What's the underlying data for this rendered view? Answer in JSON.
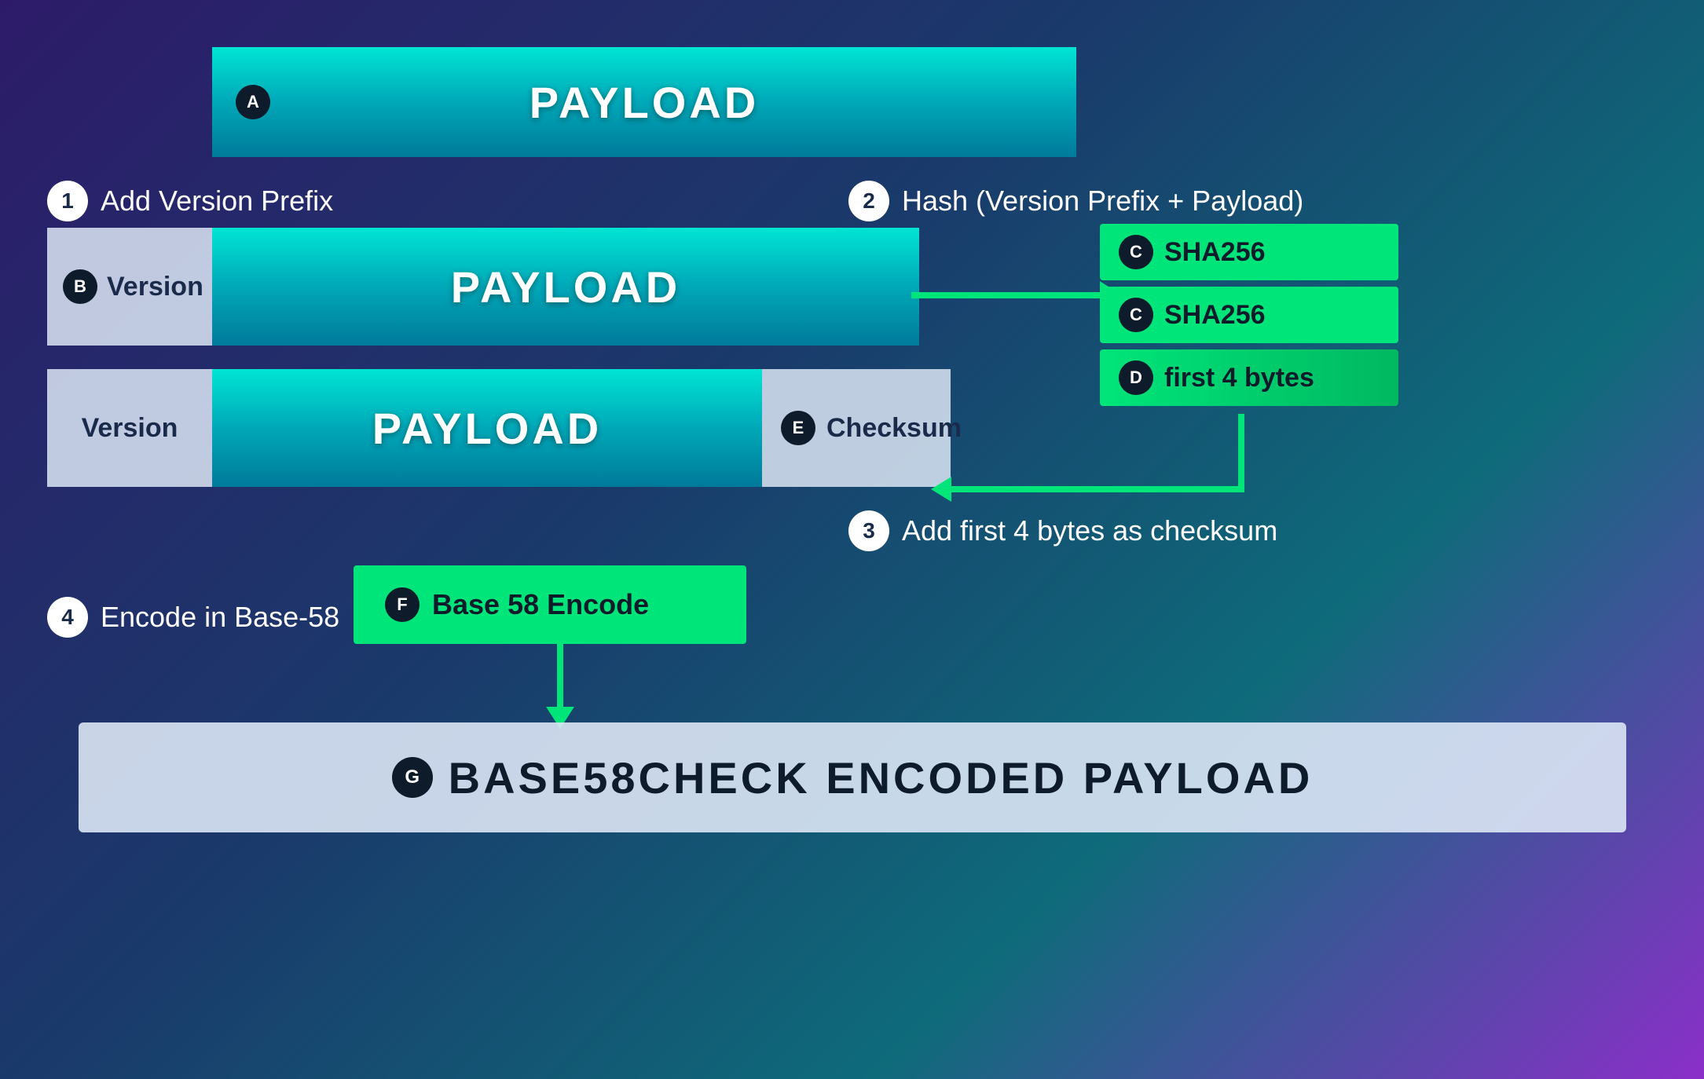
{
  "steps": [
    {
      "number": "1",
      "label": "Add Version Prefix"
    },
    {
      "number": "2",
      "label": "Hash (Version Prefix + Payload)"
    },
    {
      "number": "3",
      "label": "Add first 4 bytes as checksum"
    },
    {
      "number": "4",
      "label": "Encode in Base-58"
    }
  ],
  "badges": {
    "A": "A",
    "B": "B",
    "C": "C",
    "D": "D",
    "E": "E",
    "F": "F",
    "G": "G"
  },
  "labels": {
    "payload": "PAYLOAD",
    "version": "Version",
    "sha256": "SHA256",
    "first4bytes": "first 4 bytes",
    "checksum": "Checksum",
    "base58encode": "Base 58 Encode",
    "output": "BASE58CHECK ENCODED PAYLOAD"
  }
}
